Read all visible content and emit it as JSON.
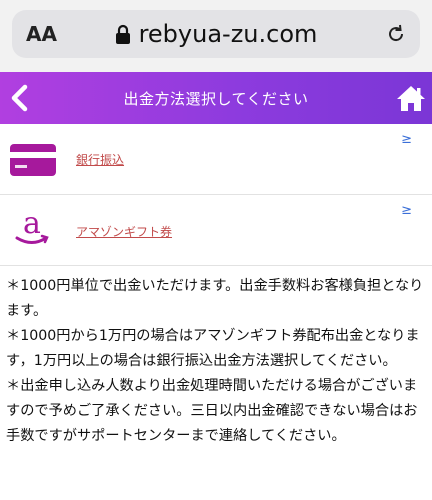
{
  "browser": {
    "aa_label": "AA",
    "url": "rebyua-zu.com"
  },
  "header": {
    "title": "出金方法選択してください"
  },
  "methods": [
    {
      "label": "銀行振込",
      "arrow": "≥",
      "icon": "credit-card-icon",
      "color": "#a6199c"
    },
    {
      "label": "アマゾンギフト券",
      "arrow": "≥",
      "icon": "amazon-logo-icon",
      "color": "#a6199c"
    }
  ],
  "notes": [
    "＊1000円単位で出金いただけます。出金手数料お客様負担となります。",
    "＊1000円から1万円の場合はアマゾンギフト券配布出金となります，1万円以上の場合は銀行振込出金方法選択してください。",
    "＊出金申し込み人数より出金処理時間いただける場合がございますので予めご了承ください。三日以内出金確認できない場合はお手数ですがサポートセンターまで連絡してください。"
  ],
  "colors": {
    "nav_gradient_start": "#b13fe0",
    "nav_gradient_end": "#7b36d6",
    "link": "#c14a4a",
    "arrow": "#3b6fd8"
  }
}
